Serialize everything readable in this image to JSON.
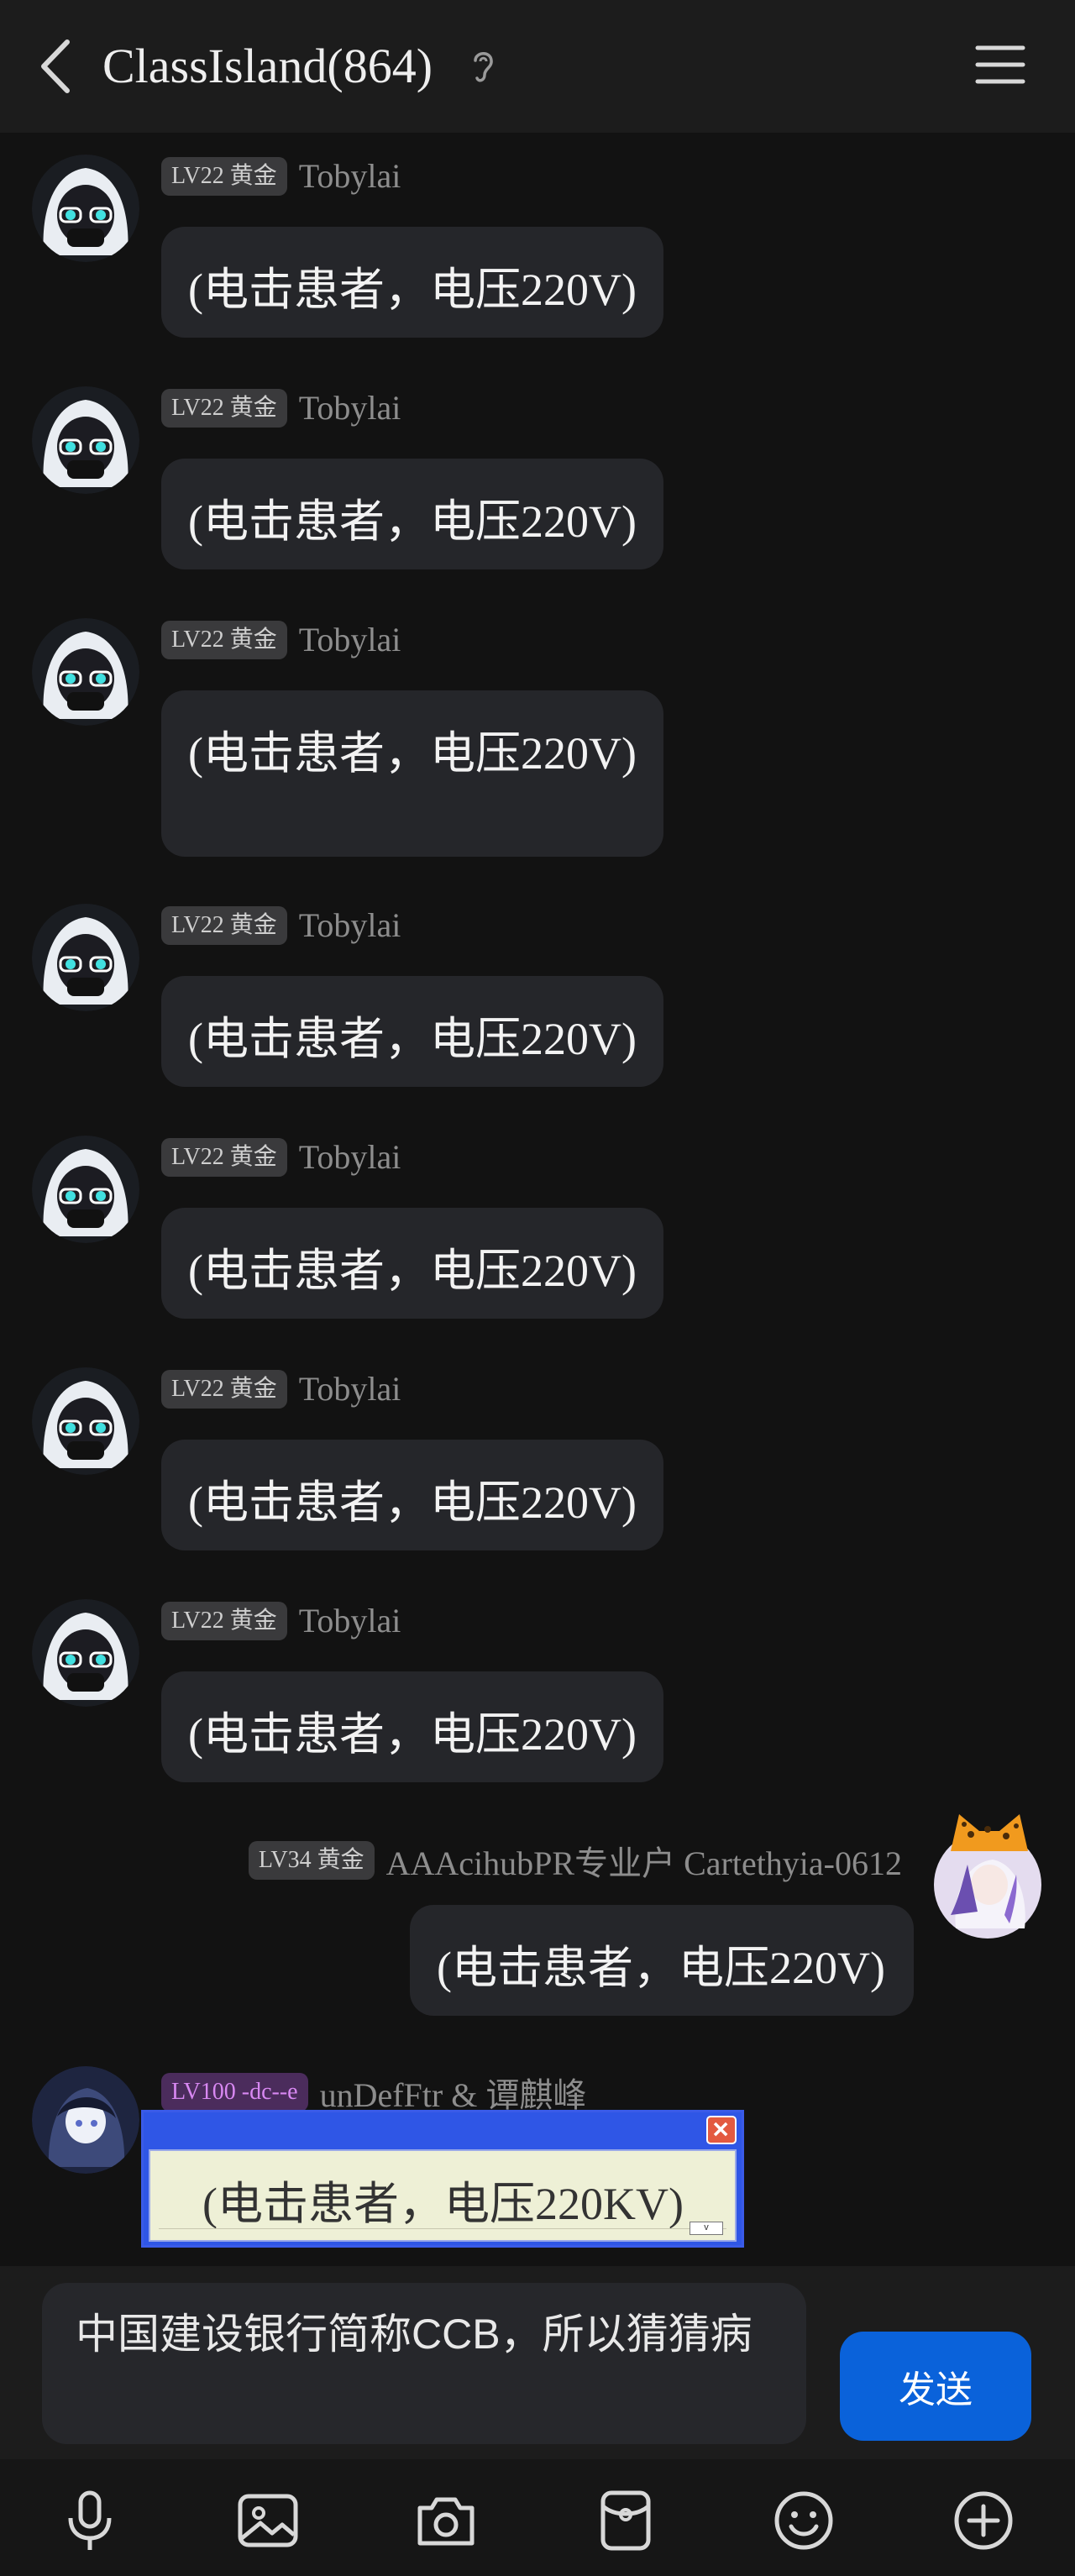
{
  "header": {
    "title": "ClassIsland(864)",
    "back_icon": "chevron-left-icon",
    "ear_icon": "ear-icon",
    "menu_icon": "hamburger-menu-icon"
  },
  "messages": [
    {
      "level": "LV22 黄金",
      "name": "Tobylai",
      "text": "(电击患者，电压220V)"
    },
    {
      "level": "LV22 黄金",
      "name": "Tobylai",
      "text": "(电击患者，电压220V)"
    },
    {
      "level": "LV22 黄金",
      "name": "Tobylai",
      "text": "(电击患者，电压220V)"
    },
    {
      "level": "LV22 黄金",
      "name": "Tobylai",
      "text": "(电击患者，电压220V)"
    },
    {
      "level": "LV22 黄金",
      "name": "Tobylai",
      "text": "(电击患者，电压220V)"
    },
    {
      "level": "LV22 黄金",
      "name": "Tobylai",
      "text": "(电击患者，电压220V)"
    },
    {
      "level": "LV22 黄金",
      "name": "Tobylai",
      "text": "(电击患者，电压220V)"
    },
    {
      "level": "LV34 黄金",
      "name": "AAAcihubPR专业户 Cartethyia-0612",
      "text": "(电击患者，电压220V)"
    },
    {
      "level": "LV100 -dc--e",
      "name": "unDefFtr & 谭麒峰",
      "text": "(电击患者，电压220KV)",
      "xp_button": "v"
    }
  ],
  "composer": {
    "input_value": "中国建设银行简称CCB，所以猜猜病",
    "send_label": "发送"
  },
  "toolbar": {
    "icons": [
      "microphone-icon",
      "image-icon",
      "camera-icon",
      "red-packet-icon",
      "emoji-icon",
      "plus-icon"
    ]
  },
  "colors": {
    "background": "#121212",
    "bubble": "#25262a",
    "send_button": "#0a62da",
    "xp_title_bar": "#2f56e6"
  }
}
